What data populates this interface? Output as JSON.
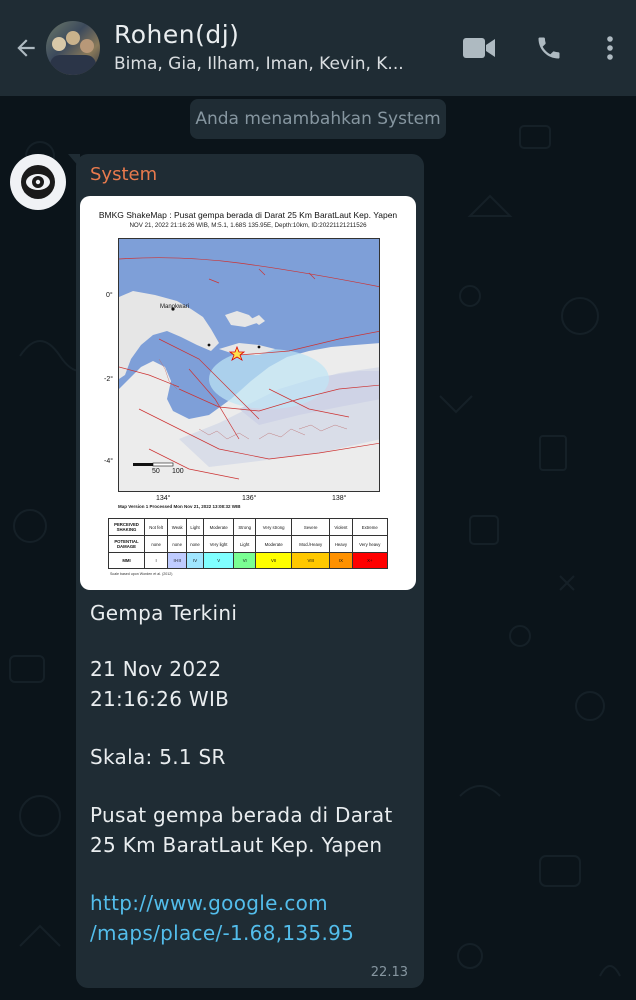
{
  "header": {
    "title": "Rohen(dj)",
    "subtitle": "Bima, Gia, Ilham, Iman, Kevin, K...",
    "back_icon": "arrow-left-icon",
    "video_icon": "video-call-icon",
    "call_icon": "phone-icon",
    "menu_icon": "more-vertical-icon"
  },
  "system_notice": "Anda menambahkan System",
  "message": {
    "sender": "System",
    "sender_color": "#e87a4d",
    "image": {
      "title": "BMKG ShakeMap : Pusat gempa berada di Darat 25 Km BaratLaut Kep. Yapen",
      "subtitle": "NOV 21, 2022 21:16:26 WIB, M:5.1, 1.68S 135.95E, Depth:10km, ID:20221121211526",
      "lat_labels": [
        "0°",
        "-2°",
        "-4°"
      ],
      "lon_labels": [
        "134°",
        "136°",
        "138°"
      ],
      "place_label": "Manokwari",
      "scale_labels": [
        "50",
        "100"
      ],
      "version": "Map Version 1 Processed Mon Nov 21, 2022 13:08:32 WIB",
      "table": {
        "perceived_label": "PERCEIVED SHAKING",
        "damage_label": "POTENTIAL DAMAGE",
        "mmi_label": "MMI",
        "perceived": [
          "Not felt",
          "Weak",
          "Light",
          "Moderate",
          "Strong",
          "Very strong",
          "Severe",
          "Violent",
          "Extreme"
        ],
        "damage": [
          "none",
          "none",
          "none",
          "Very light",
          "Light",
          "Moderate",
          "Mod./Heavy",
          "Heavy",
          "Very heavy"
        ],
        "mmi": [
          "I",
          "II-III",
          "IV",
          "V",
          "VI",
          "VII",
          "VIII",
          "IX",
          "X+"
        ],
        "colors": [
          "#ffffff",
          "#bfccff",
          "#a0e6ff",
          "#80ffff",
          "#7aff93",
          "#ffff00",
          "#ffc800",
          "#ff9100",
          "#ff0000"
        ]
      },
      "scale_note": "Scale based upon Worden et al. (2012)"
    },
    "lines": {
      "l1": "Gempa Terkini",
      "l2": "21 Nov 2022",
      "l3": "21:16:26 WIB",
      "l4": "Skala: 5.1 SR",
      "l5": "Pusat gempa berada di Darat",
      "l6": "25 Km BaratLaut Kep. Yapen",
      "link1": "http://www.google.com",
      "link2": "/maps/place/-1.68,135.95"
    },
    "time": "22.13"
  },
  "colors": {
    "header_bg": "#1f2c34",
    "chat_bg": "#0b141a",
    "bubble_bg": "#1f2c34",
    "link": "#53bdeb"
  }
}
